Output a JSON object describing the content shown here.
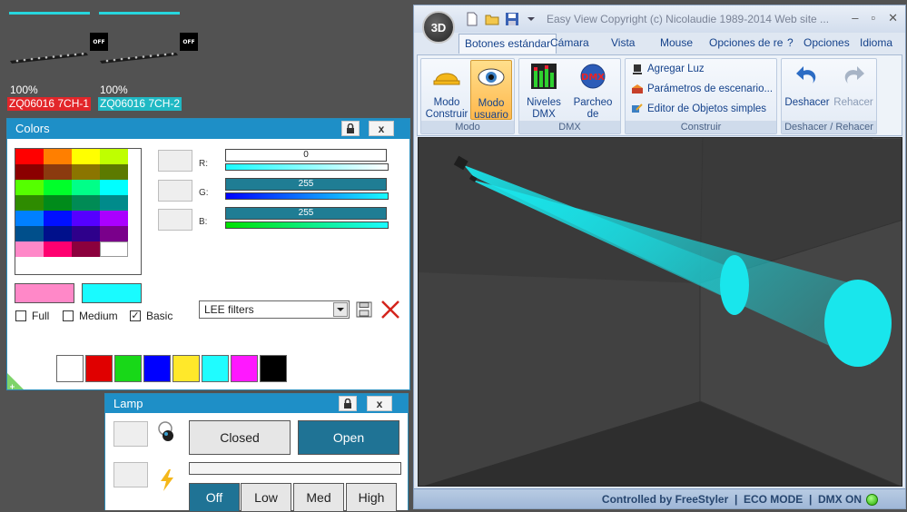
{
  "fixtures": [
    {
      "pct": "100%",
      "name": "ZQ06016 7CH-1",
      "name_bg": "#e2262a",
      "off": "OFF"
    },
    {
      "pct": "100%",
      "name": "ZQ06016 7CH-2",
      "name_bg": "#20b9c4",
      "off": "OFF"
    }
  ],
  "colors_panel": {
    "title": "Colors",
    "lock_icon": "lock-icon",
    "close_label": "x",
    "channels": [
      {
        "label": "R:",
        "value": "0"
      },
      {
        "label": "G:",
        "value": "255"
      },
      {
        "label": "B:",
        "value": "255"
      }
    ],
    "filter_select": "LEE filters",
    "checks": [
      {
        "label": "Full",
        "checked": false
      },
      {
        "label": "Medium",
        "checked": false
      },
      {
        "label": "Basic",
        "checked": true
      }
    ],
    "current_color": "#ff88c8",
    "target_color": "#19fbff",
    "presets": [
      "#ffffff",
      "#e00000",
      "#18d818",
      "#0000ff",
      "#ffe82a",
      "#1ffcff",
      "#ff18ff",
      "#000000"
    ]
  },
  "lamp_panel": {
    "title": "Lamp",
    "close_label": "x",
    "closed_label": "Closed",
    "open_label": "Open",
    "levels": [
      "Off",
      "Low",
      "Med",
      "High"
    ]
  },
  "app": {
    "title": "Easy View   Copyright (c) Nicolaudie 1989-2014   Web site ...",
    "orb_label": "3D",
    "tabs": [
      "Botones estándar",
      "Cámara",
      "Vista",
      "Mouse",
      "Opciones de re",
      "?",
      "Opciones",
      "Idioma"
    ],
    "groups": {
      "modo": {
        "label": "Modo",
        "buttons": [
          "Modo Construir",
          "Modo usuario"
        ]
      },
      "dmx": {
        "label": "DMX",
        "buttons": [
          "Niveles DMX",
          "Parcheo de Universos"
        ]
      },
      "construir": {
        "label": "Construir",
        "items": [
          "Agregar Luz",
          "Parámetros de escenario...",
          "Editor de Objetos simples"
        ]
      },
      "undo": {
        "label": "Deshacer / Rehacer",
        "buttons": [
          "Deshacer",
          "Rehacer"
        ]
      }
    },
    "status": "Controlled by FreeStyler  |  ECO MODE  |  DMX ON",
    "beam_color": "#19e6ec"
  }
}
